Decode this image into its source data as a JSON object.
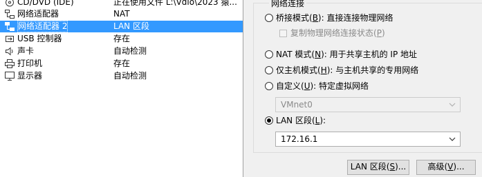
{
  "devices": [
    {
      "icon": "cd-dvd-icon",
      "name": "CD/DVD (IDE)",
      "summary": "正在使用文件 L:\\Vdio\\2023 猿...",
      "selected": false
    },
    {
      "icon": "network-adapter-icon",
      "name": "网络适配器",
      "summary": "NAT",
      "selected": false
    },
    {
      "icon": "network-adapter-icon",
      "name": "网络适配器 2",
      "summary": "LAN 区段",
      "selected": true
    },
    {
      "icon": "usb-icon",
      "name": "USB 控制器",
      "summary": "存在",
      "selected": false
    },
    {
      "icon": "speaker-icon",
      "name": "声卡",
      "summary": "自动检测",
      "selected": false
    },
    {
      "icon": "printer-icon",
      "name": "打印机",
      "summary": "存在",
      "selected": false
    },
    {
      "icon": "monitor-icon",
      "name": "显示器",
      "summary": "自动检测",
      "selected": false
    }
  ],
  "network": {
    "group_title": "网络连接",
    "bridged": {
      "label_pre": "桥接模式(",
      "key": "B",
      "label_post": "): 直接连接物理网络",
      "checked": false
    },
    "replicate": {
      "label_pre": "复制物理网络连接状态(",
      "key": "P",
      "label_post": ")",
      "checked": false,
      "enabled": false
    },
    "nat": {
      "label_pre": "NAT 模式(",
      "key": "N",
      "label_post": "): 用于共享主机的 IP 地址",
      "checked": false
    },
    "hostonly": {
      "label_pre": "仅主机模式(",
      "key": "H",
      "label_post": "): 与主机共享的专用网络",
      "checked": false
    },
    "custom": {
      "label_pre": "自定义(",
      "key": "U",
      "label_post": "): 特定虚拟网络",
      "checked": false
    },
    "custom_select": {
      "value": "VMnet0",
      "enabled": false
    },
    "lan": {
      "label_pre": "LAN 区段(",
      "key": "L",
      "label_post": "):",
      "checked": true
    },
    "lan_select": {
      "value": "172.16.1",
      "enabled": true
    }
  },
  "buttons": {
    "lan_segments": {
      "pre": "LAN 区段(",
      "key": "S",
      "post": ")..."
    },
    "advanced": {
      "pre": "高级(",
      "key": "V",
      "post": ")..."
    }
  }
}
